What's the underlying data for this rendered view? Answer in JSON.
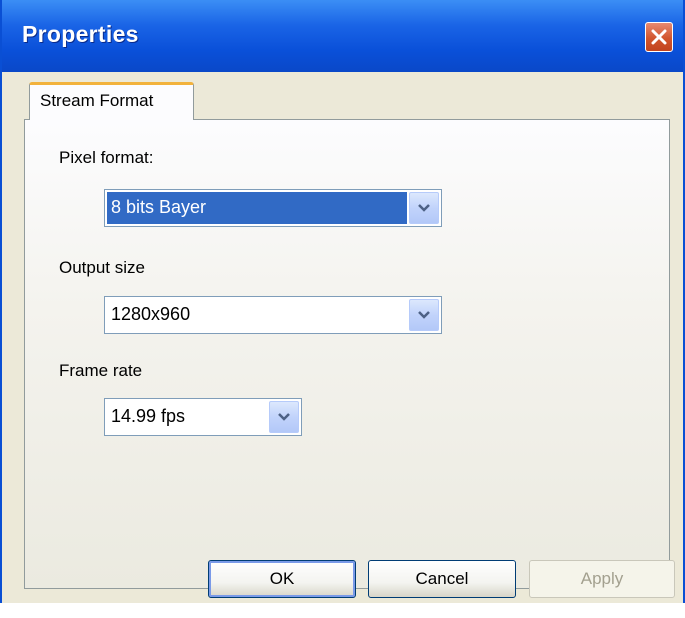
{
  "window": {
    "title": "Properties"
  },
  "tabs": [
    {
      "label": "Stream Format"
    }
  ],
  "fields": {
    "pixel_format": {
      "label": "Pixel format:",
      "value": "8 bits Bayer"
    },
    "output_size": {
      "label": "Output size",
      "value": "1280x960"
    },
    "frame_rate": {
      "label": "Frame rate",
      "value": "14.99 fps"
    }
  },
  "buttons": {
    "ok": "OK",
    "cancel": "Cancel",
    "apply": "Apply"
  },
  "icons": {
    "close": "close-icon",
    "dropdown": "chevron-down-icon"
  },
  "colors": {
    "titlebar": "#0a50d9",
    "selection": "#316ac5",
    "tab_accent": "#f2b23c",
    "close": "#d2552d"
  }
}
